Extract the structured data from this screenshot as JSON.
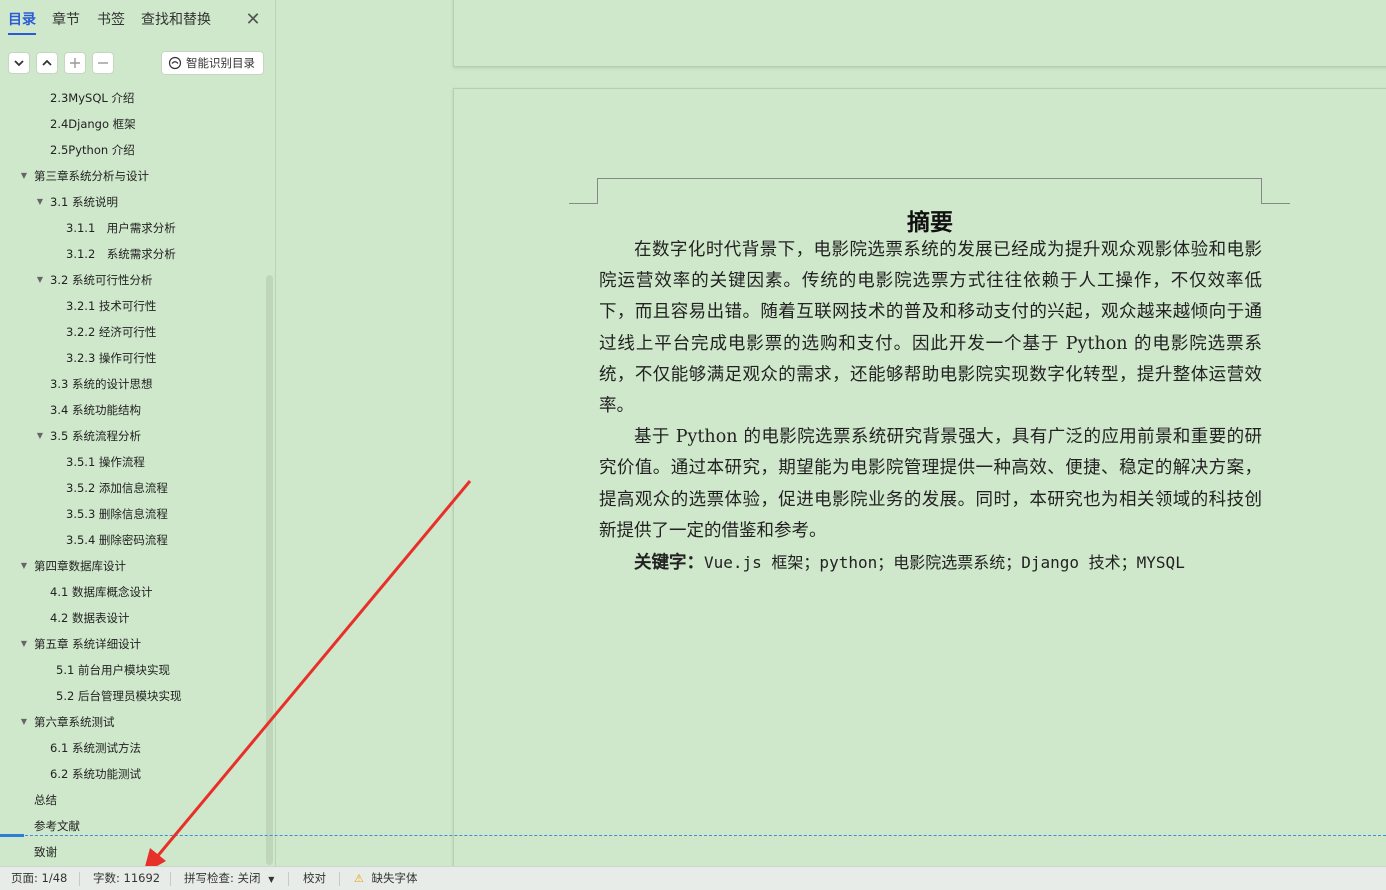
{
  "nav": {
    "tabs": [
      "目录",
      "章节",
      "书签",
      "查找和替换"
    ],
    "close_label": "✕",
    "smart_toc_label": "智能识别目录",
    "toc": [
      {
        "label": "2.3MySQL 介绍",
        "level": 2
      },
      {
        "label": "2.4Django 框架",
        "level": 2
      },
      {
        "label": "2.5Python 介绍",
        "level": 2
      },
      {
        "label": "第三章系统分析与设计",
        "level": 1,
        "expanded": true
      },
      {
        "label": "3.1 系统说明",
        "level": 2,
        "expanded": true
      },
      {
        "label": "3.1.1　用户需求分析",
        "level": 3
      },
      {
        "label": "3.1.2　系统需求分析",
        "level": 3
      },
      {
        "label": "3.2 系统可行性分析",
        "level": 2,
        "expanded": true
      },
      {
        "label": "3.2.1 技术可行性",
        "level": 3
      },
      {
        "label": "3.2.2 经济可行性",
        "level": 3
      },
      {
        "label": "3.2.3 操作可行性",
        "level": 3
      },
      {
        "label": "3.3 系统的设计思想",
        "level": 2
      },
      {
        "label": "3.4 系统功能结构",
        "level": 2
      },
      {
        "label": "3.5 系统流程分析",
        "level": 2,
        "expanded": true
      },
      {
        "label": "3.5.1 操作流程",
        "level": 3
      },
      {
        "label": "3.5.2 添加信息流程",
        "level": 3
      },
      {
        "label": "3.5.3 删除信息流程",
        "level": 3
      },
      {
        "label": "3.5.4 删除密码流程",
        "level": 3
      },
      {
        "label": "第四章数据库设计",
        "level": 1,
        "expanded": true
      },
      {
        "label": "4.1 数据库概念设计",
        "level": 2
      },
      {
        "label": "4.2 数据表设计",
        "level": 2
      },
      {
        "label": "第五章  系统详细设计",
        "level": 1,
        "expanded": true
      },
      {
        "label": "5.1 前台用户模块实现",
        "level": 2
      },
      {
        "label": "5.2 后台管理员模块实现",
        "level": 2
      },
      {
        "label": "第六章系统测试",
        "level": 1,
        "expanded": true
      },
      {
        "label": "6.1 系统测试方法",
        "level": 2
      },
      {
        "label": "6.2 系统功能测试",
        "level": 2
      },
      {
        "label": "总结",
        "level": 1
      },
      {
        "label": "参考文献",
        "level": 1
      },
      {
        "label": "致谢",
        "level": 1
      }
    ]
  },
  "document": {
    "title": "摘要",
    "paragraphs": [
      "在数字化时代背景下，电影院选票系统的发展已经成为提升观众观影体验和电影院运营效率的关键因素。传统的电影院选票方式往往依赖于人工操作，不仅效率低下，而且容易出错。随着互联网技术的普及和移动支付的兴起，观众越来越倾向于通过线上平台完成电影票的选购和支付。因此开发一个基于 Python 的电影院选票系统，不仅能够满足观众的需求，还能够帮助电影院实现数字化转型，提升整体运营效率。",
      "基于 Python 的电影院选票系统研究背景强大，具有广泛的应用前景和重要的研究价值。通过本研究，期望能为电影院管理提供一种高效、便捷、稳定的解决方案，提高观众的选票体验，促进电影院业务的发展。同时，本研究也为相关领域的科技创新提供了一定的借鉴和参考。"
    ],
    "keywords_label": "关键字：",
    "keywords_text": "Vue.js 框架；python；电影院选票系统；Django 技术；MYSQL"
  },
  "status": {
    "page": "页面: 1/48",
    "word_count": "字数: 11692",
    "spell_check": "拼写检查: 关闭",
    "proofread": "校对",
    "missing_font": "缺失字体"
  },
  "colors": {
    "background": "#cfe8cb",
    "accent": "#2a5bd7",
    "arrow": "#e8302a",
    "warning": "#e8a000"
  }
}
